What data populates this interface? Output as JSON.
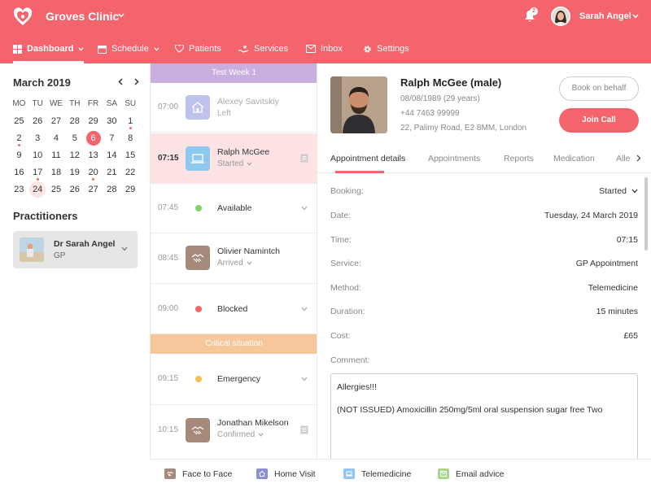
{
  "header": {
    "clinic_name": "Groves Clinic",
    "notification_count": "2",
    "user_name": "Sarah Angel",
    "brand_color": "#f3646c"
  },
  "nav": [
    {
      "label": "Dashboard",
      "icon": "dashboard-icon",
      "active": true
    },
    {
      "label": "Schedule",
      "icon": "calendar-icon"
    },
    {
      "label": "Patients",
      "icon": "heart-icon"
    },
    {
      "label": "Services",
      "icon": "hand-heart-icon"
    },
    {
      "label": "Inbox",
      "icon": "mail-icon"
    },
    {
      "label": "Settings",
      "icon": "gear-icon"
    }
  ],
  "calendar": {
    "title": "March 2019",
    "weekdays": [
      "MO",
      "TU",
      "WE",
      "TH",
      "FR",
      "SA",
      "SU"
    ],
    "weeks": [
      [
        "25",
        "26",
        "27",
        "28",
        "29",
        "30",
        "1"
      ],
      [
        "2",
        "3",
        "4",
        "5",
        "6",
        "7",
        "8"
      ],
      [
        "9",
        "10",
        "11",
        "12",
        "13",
        "14",
        "15"
      ],
      [
        "16",
        "17",
        "18",
        "19",
        "20",
        "21",
        "22"
      ],
      [
        "23",
        "24",
        "25",
        "26",
        "27",
        "28",
        "29"
      ]
    ],
    "today": "6",
    "selected": "24"
  },
  "practitioners": {
    "title": "Practitioners",
    "items": [
      {
        "name": "Dr Sarah Angel",
        "role": "GP"
      }
    ]
  },
  "schedule": {
    "bands": [
      {
        "label": "Test Week 1",
        "color": "#c9aee0"
      },
      {
        "label": "Critical situation",
        "color": "#f6c79a"
      }
    ],
    "slots": [
      {
        "time": "07:00",
        "name": "Alexey Savitskiy",
        "status": "Left",
        "type": "home-visit"
      },
      {
        "time": "07:15",
        "name": "Ralph McGee",
        "status": "Started",
        "type": "telemedicine"
      },
      {
        "time": "07:45",
        "name": "Available",
        "status_color": "#7ed36b"
      },
      {
        "time": "08:45",
        "name": "Olivier Namintch",
        "status": "Arrived",
        "type": "face-to-face"
      },
      {
        "time": "09:00",
        "name": "Blocked",
        "status_color": "#f3646c"
      },
      {
        "time": "09:15",
        "name": "Emergency",
        "status_color": "#f5c04c"
      },
      {
        "time": "10:15",
        "name": "Jonathan Mikelson",
        "status": "Confirmed",
        "type": "face-to-face"
      }
    ]
  },
  "patient": {
    "name": "Ralph McGee (male)",
    "dob": "08/08/1989 (29 years)",
    "phone": "+44 7463 99999",
    "address": "22, Palimy Road, E2 8MM, London",
    "book_label": "Book on behalf",
    "join_label": "Join Call"
  },
  "tabs": [
    "Appointment details",
    "Appointments",
    "Reports",
    "Medication",
    "Alle"
  ],
  "appointment": {
    "fields": [
      {
        "label": "Booking:",
        "value": "Started"
      },
      {
        "label": "Date:",
        "value": "Tuesday, 24 March 2019"
      },
      {
        "label": "Time:",
        "value": "07:15"
      },
      {
        "label": "Service:",
        "value": "GP Appointment"
      },
      {
        "label": "Method:",
        "value": "Telemedicine"
      },
      {
        "label": "Duration:",
        "value": "15 minutes"
      },
      {
        "label": "Cost:",
        "value": "£65"
      }
    ],
    "comment_label": "Comment:",
    "comment": "Allergies!!!\n\n(NOT ISSUED) Amoxicillin 250mg/5ml oral suspension sugar free Two"
  },
  "legend": [
    {
      "label": "Face to Face",
      "color": "#a58a7c"
    },
    {
      "label": "Home Visit",
      "color": "#8a8fd6"
    },
    {
      "label": "Telemedicine",
      "color": "#8ec8ee"
    },
    {
      "label": "Email advice",
      "color": "#a8d98a"
    }
  ]
}
